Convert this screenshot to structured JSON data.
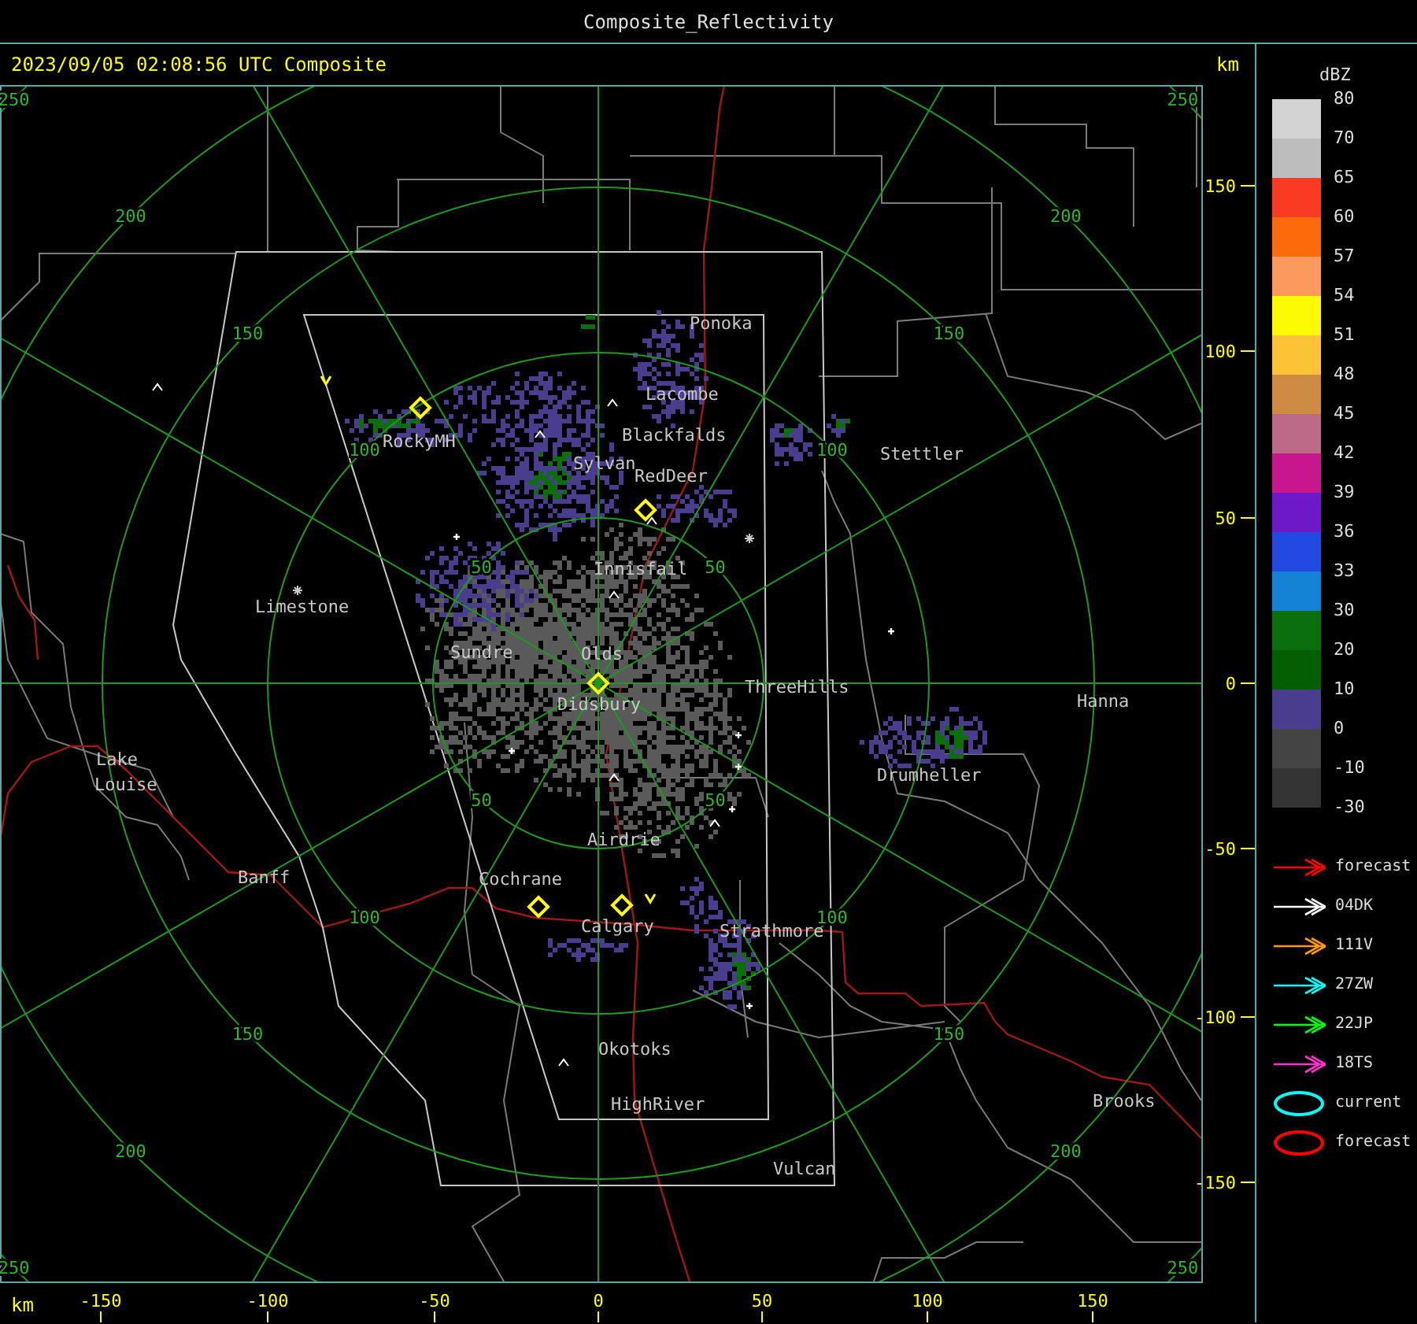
{
  "window": {
    "title": "Composite_Reflectivity"
  },
  "header": {
    "timestamp": "2023/09/05 02:08:56 UTC Composite",
    "unit": "km"
  },
  "range_ring_labels": {
    "nw": [
      "50",
      "100",
      "150",
      "200",
      "250"
    ],
    "ne": [
      "50",
      "100",
      "150",
      "200",
      "250"
    ],
    "sw": [
      "50",
      "100",
      "150",
      "200",
      "250"
    ],
    "se": [
      "50",
      "100",
      "150",
      "200",
      "250"
    ]
  },
  "cities": [
    {
      "name": "Ponoka"
    },
    {
      "name": "Lacombe"
    },
    {
      "name": "Blackfalds"
    },
    {
      "name": "RockyMH"
    },
    {
      "name": "Sylvan"
    },
    {
      "name": "RedDeer"
    },
    {
      "name": "Stettler"
    },
    {
      "name": "Innisfail"
    },
    {
      "name": "Limestone"
    },
    {
      "name": "Sundre"
    },
    {
      "name": "Olds"
    },
    {
      "name": "ThreeHills"
    },
    {
      "name": "Didsbury"
    },
    {
      "name": "Hanna"
    },
    {
      "name": "Lake"
    },
    {
      "name": "Louise"
    },
    {
      "name": "Drumheller"
    },
    {
      "name": "Airdrie"
    },
    {
      "name": "Banff"
    },
    {
      "name": "Cochrane"
    },
    {
      "name": "Calgary"
    },
    {
      "name": "Strathmore"
    },
    {
      "name": "Okotoks"
    },
    {
      "name": "HighRiver"
    },
    {
      "name": "Brooks"
    },
    {
      "name": "Vulcan"
    }
  ],
  "y_axis": {
    "ticks": [
      "150",
      "100",
      "50",
      "0",
      "-50",
      "-100",
      "-150"
    ]
  },
  "x_axis": {
    "unit": "km",
    "ticks": [
      "-150",
      "-100",
      "-50",
      "0",
      "50",
      "100",
      "150"
    ]
  },
  "legend": {
    "unit": "dBZ",
    "scale": [
      {
        "color": "#d3d3d3"
      },
      {
        "color": "#bdbdbd"
      },
      {
        "color": "#f93b23"
      },
      {
        "color": "#fc6a0c"
      },
      {
        "color": "#fb9a5c"
      },
      {
        "color": "#fdfb04"
      },
      {
        "color": "#fbc335"
      },
      {
        "color": "#ce8b41"
      },
      {
        "color": "#bc6a88"
      },
      {
        "color": "#c8168e"
      },
      {
        "color": "#6d19c8"
      },
      {
        "color": "#2148e0"
      },
      {
        "color": "#1483d6"
      },
      {
        "color": "#0a6e0a"
      },
      {
        "color": "#045e04"
      },
      {
        "color": "#4a3d8e"
      },
      {
        "color": "#444444"
      },
      {
        "color": "#333333"
      }
    ],
    "scale_labels": [
      "80",
      "70",
      "65",
      "60",
      "57",
      "54",
      "51",
      "48",
      "45",
      "42",
      "39",
      "36",
      "33",
      "30",
      "20",
      "10",
      "0",
      "-10",
      "-30"
    ],
    "tracks": [
      {
        "kind": "arrow",
        "label": "forecast",
        "color": "#ff0000"
      },
      {
        "kind": "arrow",
        "label": "04DK",
        "color": "#ffffff"
      },
      {
        "kind": "arrow",
        "label": "111V",
        "color": "#ff9900"
      },
      {
        "kind": "arrow",
        "label": "27ZW",
        "color": "#00ffff"
      },
      {
        "kind": "arrow",
        "label": "22JP",
        "color": "#00ff00"
      },
      {
        "kind": "arrow",
        "label": "18TS",
        "color": "#ff33cc"
      },
      {
        "kind": "ellipse",
        "label": "current",
        "color": "#00ffff"
      },
      {
        "kind": "ellipse",
        "label": "forecast",
        "color": "#ff0000"
      }
    ]
  }
}
